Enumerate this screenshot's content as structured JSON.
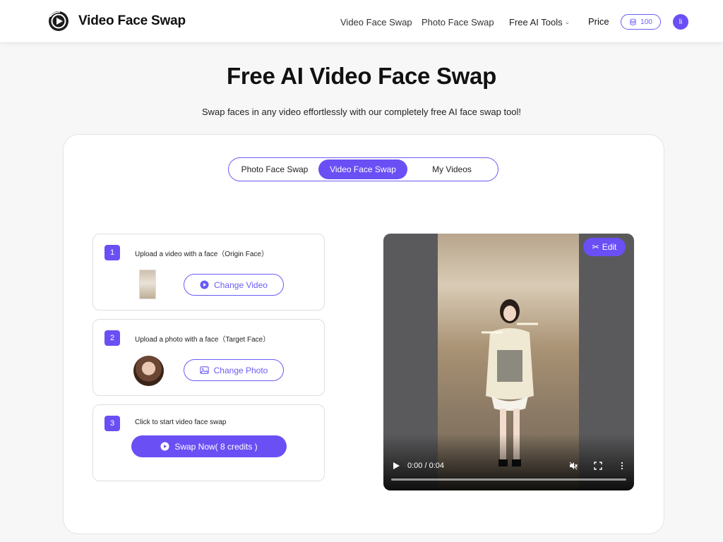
{
  "header": {
    "brand": "Video Face Swap",
    "nav": {
      "video_face_swap": "Video Face Swap",
      "photo_face_swap": "Photo Face Swap",
      "free_ai_tools": "Free AI Tools",
      "price": "Price"
    },
    "credits": "100",
    "avatar_initial": "li"
  },
  "hero": {
    "title": "Free AI Video Face Swap",
    "subtitle": "Swap faces in any video effortlessly with our completely free AI face swap tool!"
  },
  "tabs": {
    "photo": "Photo Face Swap",
    "video": "Video Face Swap",
    "my_videos": "My Videos",
    "active": "video"
  },
  "steps": [
    {
      "num": "1",
      "label": "Upload a video with a face（Origin Face）",
      "button": "Change Video",
      "icon": "play-circle-icon"
    },
    {
      "num": "2",
      "label": "Upload a photo with a face（Target Face）",
      "button": "Change Photo",
      "icon": "image-icon"
    },
    {
      "num": "3",
      "label": "Click to start video face swap",
      "button": "Swap Now( 8 credits )",
      "icon": "play-circle-icon"
    }
  ],
  "player": {
    "edit_label": "Edit",
    "time": "0:00 / 0:04",
    "progress": 0.0
  },
  "colors": {
    "accent": "#6a4ff5",
    "accent_outline": "#6a5cf5"
  }
}
